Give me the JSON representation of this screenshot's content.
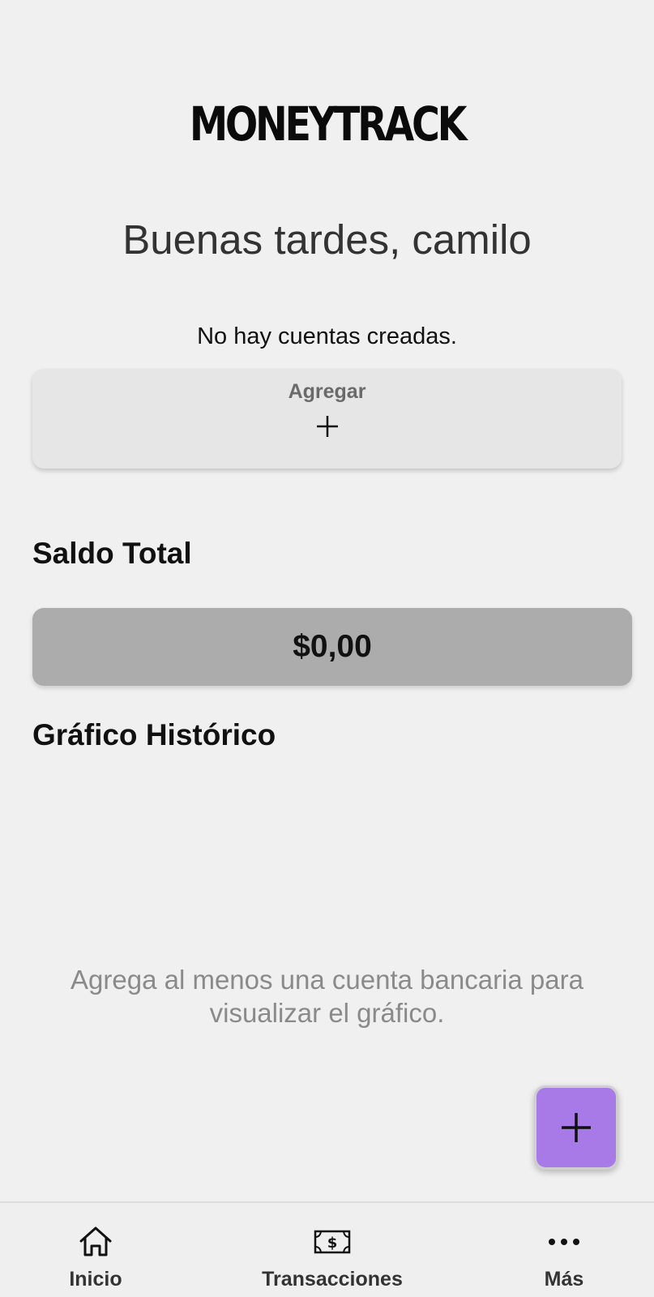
{
  "app": {
    "logo_text": "MONEYTRACK"
  },
  "home": {
    "greeting": "Buenas tardes, camilo",
    "no_accounts_text": "No hay cuentas creadas.",
    "add_account_label": "Agregar"
  },
  "balance": {
    "title": "Saldo Total",
    "value": "$0,00"
  },
  "chart": {
    "title": "Gráfico Histórico",
    "empty_message": "Agrega al menos una cuenta bancaria para visualizar el gráfico."
  },
  "fab": {
    "icon": "plus-icon",
    "color": "#a87ae8"
  },
  "nav": {
    "items": [
      {
        "label": "Inicio",
        "icon": "home-icon"
      },
      {
        "label": "Transacciones",
        "icon": "cash-icon"
      },
      {
        "label": "Más",
        "icon": "more-horizontal-icon"
      }
    ]
  }
}
